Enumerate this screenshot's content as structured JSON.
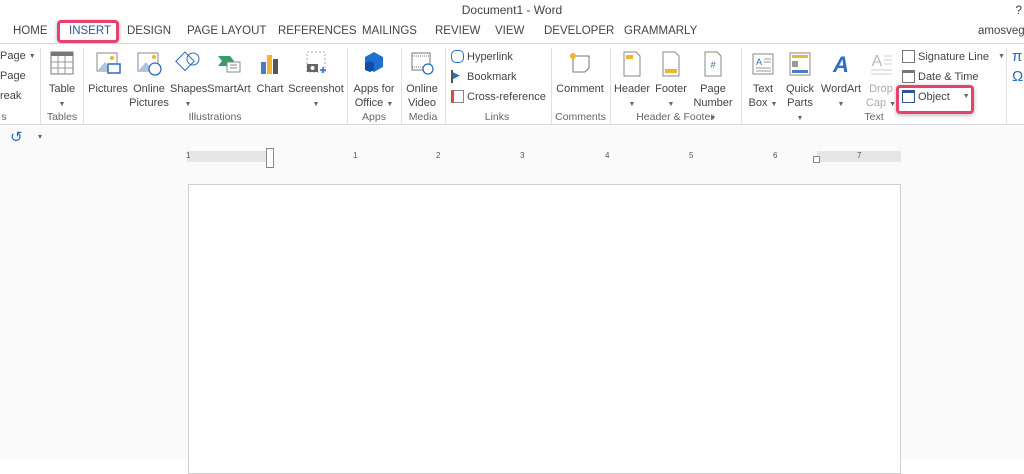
{
  "window": {
    "title": "Document1 - Word",
    "help": "?",
    "user": "amosvegal"
  },
  "tabs": [
    {
      "label": "HOME"
    },
    {
      "label": "INSERT",
      "active": true
    },
    {
      "label": "DESIGN"
    },
    {
      "label": "PAGE LAYOUT"
    },
    {
      "label": "REFERENCES"
    },
    {
      "label": "MAILINGS"
    },
    {
      "label": "REVIEW"
    },
    {
      "label": "VIEW"
    },
    {
      "label": "DEVELOPER"
    },
    {
      "label": "GRAMMARLY"
    }
  ],
  "ribbon": {
    "pages": {
      "items": [
        "Page",
        "Page",
        "reak"
      ],
      "label": "s"
    },
    "tables": {
      "table": "Table",
      "label": "Tables"
    },
    "illustrations": {
      "pictures": "Pictures",
      "online_pictures": "Online Pictures",
      "shapes": "Shapes",
      "smartart": "SmartArt",
      "chart": "Chart",
      "screenshot": "Screenshot",
      "label": "Illustrations"
    },
    "apps": {
      "apps_for_office": "Apps for Office",
      "label": "Apps"
    },
    "media": {
      "online_video": "Online Video",
      "label": "Media"
    },
    "links": {
      "hyperlink": "Hyperlink",
      "bookmark": "Bookmark",
      "cross_reference": "Cross-reference",
      "label": "Links"
    },
    "comments": {
      "comment": "Comment",
      "label": "Comments"
    },
    "header_footer": {
      "header": "Header",
      "footer": "Footer",
      "page_number": "Page Number",
      "label": "Header & Footer"
    },
    "text": {
      "text_box": "Text Box",
      "quick_parts": "Quick Parts",
      "wordart": "WordArt",
      "drop_cap": "Drop Cap",
      "signature_line": "Signature Line",
      "date_time": "Date & Time",
      "object": "Object",
      "label": "Text"
    },
    "symbols": {
      "equation": "π",
      "symbol": "Ω"
    }
  },
  "ruler": {
    "numbers": [
      "1",
      "1",
      "2",
      "3",
      "4",
      "5",
      "6",
      "7"
    ]
  },
  "colors": {
    "accent": "#2b579a",
    "highlight": "#e8416f"
  }
}
